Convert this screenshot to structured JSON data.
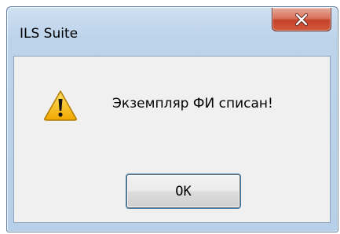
{
  "window": {
    "title": "ILS Suite"
  },
  "dialog": {
    "icon": "warning-icon",
    "message": "Экземпляр ФИ списан!",
    "ok_label": "OK"
  },
  "controls": {
    "close_icon": "close-icon"
  },
  "colors": {
    "frame": "#bcd3ea",
    "client": "#f0f0f0",
    "close_button": "#c4422a",
    "warning_fill": "#f7c200"
  }
}
